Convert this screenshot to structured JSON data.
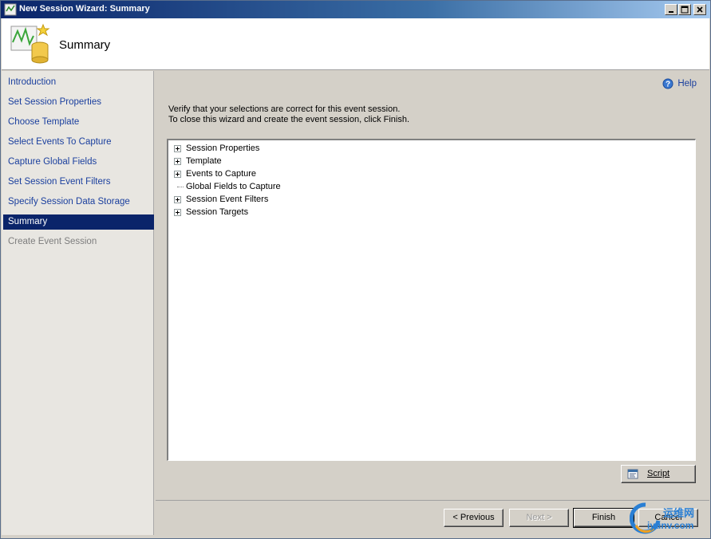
{
  "window": {
    "title": "New Session Wizard: Summary"
  },
  "header": {
    "title": "Summary"
  },
  "nav": {
    "items": [
      {
        "label": "Introduction",
        "state": "link"
      },
      {
        "label": "Set Session Properties",
        "state": "link"
      },
      {
        "label": "Choose Template",
        "state": "link"
      },
      {
        "label": "Select Events To Capture",
        "state": "link"
      },
      {
        "label": "Capture Global Fields",
        "state": "link"
      },
      {
        "label": "Set Session Event Filters",
        "state": "link"
      },
      {
        "label": "Specify Session Data Storage",
        "state": "link"
      },
      {
        "label": "Summary",
        "state": "active"
      },
      {
        "label": "Create Event Session",
        "state": "disabled"
      }
    ]
  },
  "main": {
    "help_label": "Help",
    "description_line1": "Verify that your selections are correct for this event session.",
    "description_line2": "To close this wizard and create the event session, click Finish.",
    "tree": [
      {
        "label": "Session Properties",
        "expandable": true
      },
      {
        "label": "Template",
        "expandable": true
      },
      {
        "label": "Events to Capture",
        "expandable": true
      },
      {
        "label": "Global Fields to Capture",
        "expandable": false
      },
      {
        "label": "Session Event Filters",
        "expandable": true
      },
      {
        "label": "Session Targets",
        "expandable": true
      }
    ],
    "script_button": "Script"
  },
  "footer": {
    "previous_label": "< Previous",
    "next_label": "Next >",
    "finish_label": "Finish",
    "cancel_label": "Cancel"
  },
  "watermark": {
    "line1": "运维网",
    "line2": "iyunv.com"
  },
  "colors": {
    "title_bar": "#0a246a",
    "nav_link": "#1a3f9e",
    "nav_active_bg": "#0a246a",
    "panel_bg": "#d4d0c8"
  }
}
